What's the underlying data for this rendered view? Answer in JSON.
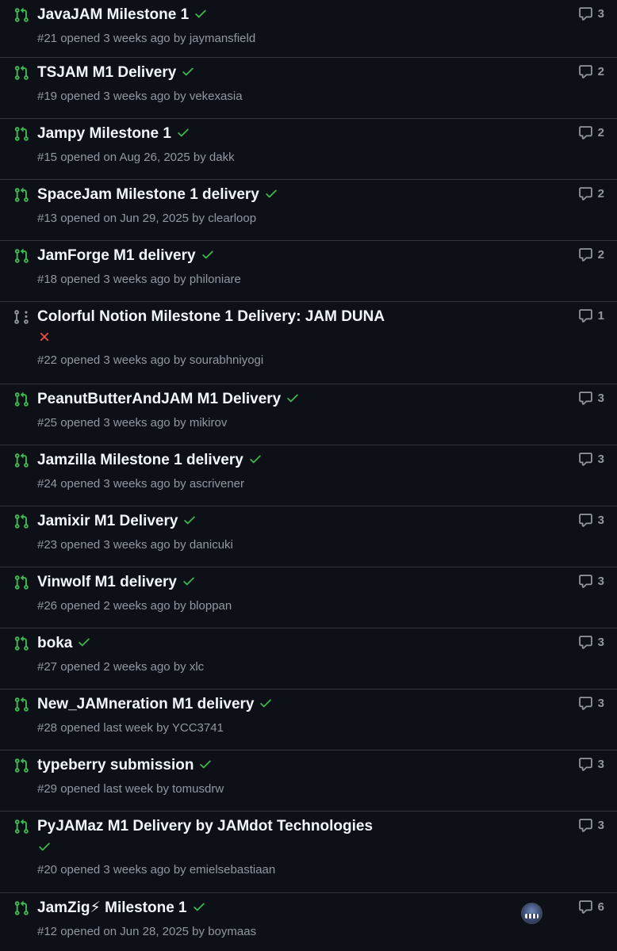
{
  "colors": {
    "background": "#0d1117",
    "open_pr": "#3fb950",
    "draft_pr": "#9198a1",
    "success": "#3fb950",
    "failure": "#f85149",
    "muted": "#9198a1"
  },
  "icons": {
    "open": "git-pull-request-icon",
    "draft": "git-pull-request-draft-icon",
    "success": "check-icon",
    "failure": "x-icon",
    "comment": "comment-icon"
  },
  "pull_requests": [
    {
      "title": "JavaJAM Milestone 1",
      "status": "success",
      "number": "#21",
      "opened": "opened 3 weeks ago by",
      "author": "jaymansfield",
      "comments": "3",
      "type": "open"
    },
    {
      "title": "TSJAM M1 Delivery",
      "status": "success",
      "number": "#19",
      "opened": "opened 3 weeks ago by",
      "author": "vekexasia",
      "comments": "2",
      "type": "open"
    },
    {
      "title": "Jampy Milestone 1",
      "status": "success",
      "number": "#15",
      "opened": "opened on Aug 26, 2025 by",
      "author": "dakk",
      "comments": "2",
      "type": "open"
    },
    {
      "title": "SpaceJam Milestone 1 delivery",
      "status": "success",
      "number": "#13",
      "opened": "opened on Jun 29, 2025 by",
      "author": "clearloop",
      "comments": "2",
      "type": "open"
    },
    {
      "title": "JamForge M1 delivery",
      "status": "success",
      "number": "#18",
      "opened": "opened 3 weeks ago by",
      "author": "philoniare",
      "comments": "2",
      "type": "open"
    },
    {
      "title": "Colorful Notion Milestone 1 Delivery: JAM DUNA",
      "status": "failure",
      "number": "#22",
      "opened": "opened 3 weeks ago by",
      "author": "sourabhniyogi",
      "comments": "1",
      "type": "draft"
    },
    {
      "title": "PeanutButterAndJAM M1 Delivery",
      "status": "success",
      "number": "#25",
      "opened": "opened 3 weeks ago by",
      "author": "mikirov",
      "comments": "3",
      "type": "open"
    },
    {
      "title": "Jamzilla Milestone 1 delivery",
      "status": "success",
      "number": "#24",
      "opened": "opened 3 weeks ago by",
      "author": "ascrivener",
      "comments": "3",
      "type": "open"
    },
    {
      "title": "Jamixir M1 Delivery",
      "status": "success",
      "number": "#23",
      "opened": "opened 3 weeks ago by",
      "author": "danicuki",
      "comments": "3",
      "type": "open"
    },
    {
      "title": "Vinwolf M1 delivery",
      "status": "success",
      "number": "#26",
      "opened": "opened 2 weeks ago by",
      "author": "bloppan",
      "comments": "3",
      "type": "open"
    },
    {
      "title": "boka",
      "status": "success",
      "number": "#27",
      "opened": "opened 2 weeks ago by",
      "author": "xlc",
      "comments": "3",
      "type": "open"
    },
    {
      "title": "New_JAMneration M1 delivery",
      "status": "success",
      "number": "#28",
      "opened": "opened last week by",
      "author": "YCC3741",
      "comments": "3",
      "type": "open"
    },
    {
      "title": "typeberry submission",
      "status": "success",
      "number": "#29",
      "opened": "opened last week by",
      "author": "tomusdrw",
      "comments": "3",
      "type": "open"
    },
    {
      "title": "PyJAMaz M1 Delivery by JAMdot Technologies",
      "status": "success",
      "number": "#20",
      "opened": "opened 3 weeks ago by",
      "author": "emielsebastiaan",
      "comments": "3",
      "type": "open"
    },
    {
      "title": "JamZig⚡ Milestone 1",
      "status": "success",
      "number": "#12",
      "opened": "opened on Jun 28, 2025 by",
      "author": "boymaas",
      "comments": "6",
      "type": "open",
      "has_avatar": true
    }
  ]
}
